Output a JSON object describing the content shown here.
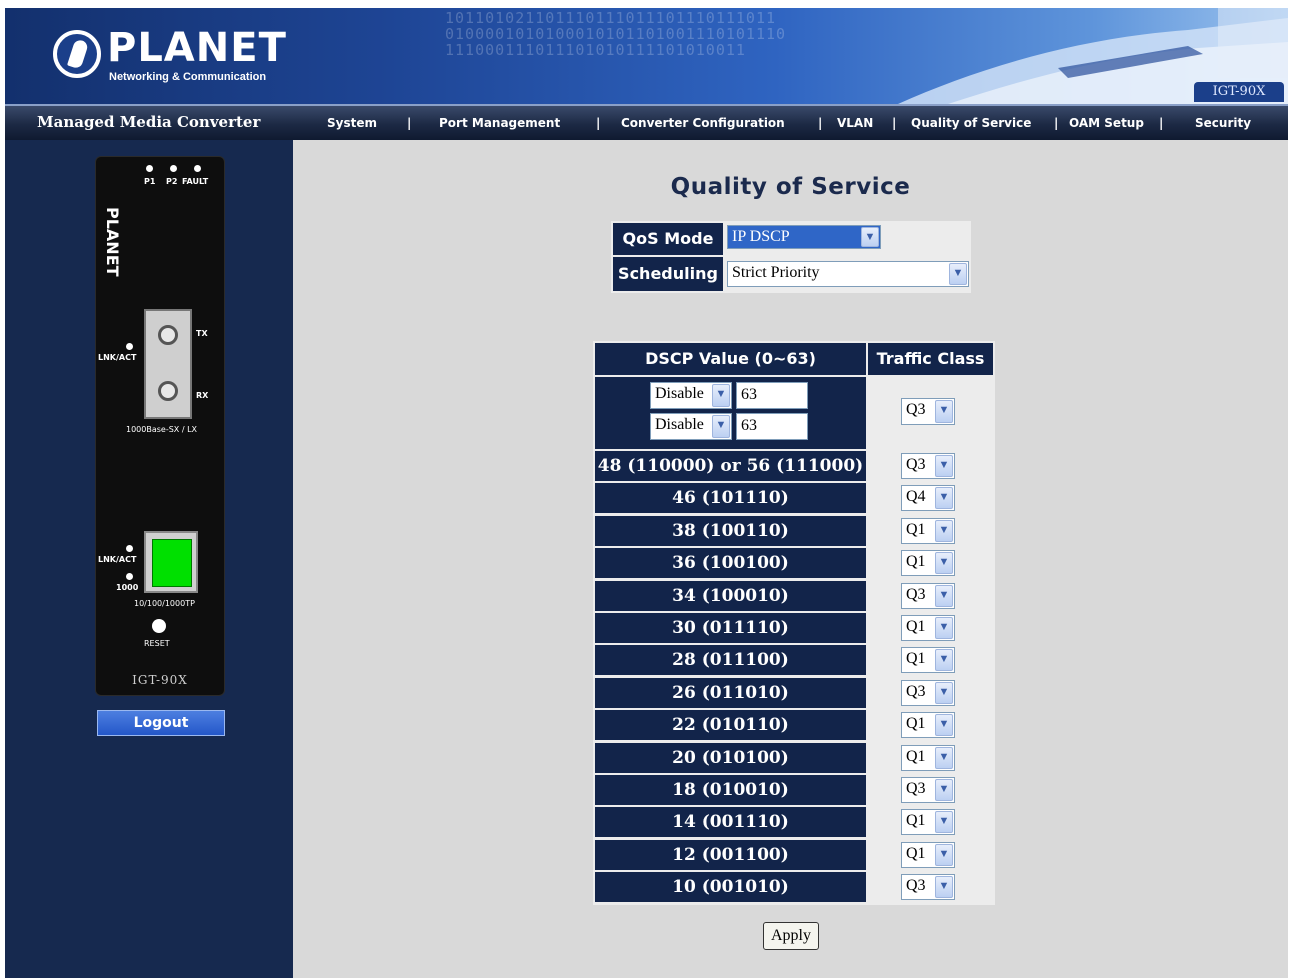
{
  "banner": {
    "logo_text": "PLANET",
    "logo_tagline": "Networking & Communication",
    "model_badge": "IGT-90X"
  },
  "navbar": {
    "product_name": "Managed Media Converter",
    "items": [
      "System",
      "Port Management",
      "Converter Configuration",
      "VLAN",
      "Quality of Service",
      "OAM Setup",
      "Security"
    ],
    "separator": "|"
  },
  "device": {
    "led_labels": {
      "p1": "P1",
      "p2": "P2",
      "fault": "FAULT"
    },
    "brand": "PLANET",
    "tx": "TX",
    "rx": "RX",
    "lnk_act": "LNK/ACT",
    "fiber_type": "1000Base-SX / LX",
    "speed_1000": "1000",
    "copper_type": "10/100/1000TP",
    "reset": "RESET",
    "model": "IGT-90X"
  },
  "left_panel": {
    "logout_label": "Logout"
  },
  "main": {
    "title": "Quality of Service",
    "qos_mode_label": "QoS Mode",
    "qos_mode_value": "IP DSCP",
    "scheduling_label": "Scheduling",
    "scheduling_value": "Strict Priority",
    "dscp_header": "DSCP Value (0~63)",
    "traffic_class_header": "Traffic Class",
    "custom_rows": [
      {
        "mode": "Disable",
        "value": "63"
      },
      {
        "mode": "Disable",
        "value": "63"
      }
    ],
    "custom_class": "Q3",
    "rows": [
      {
        "label": "48 (110000) or 56 (111000)",
        "class": "Q3"
      },
      {
        "label": "46 (101110)",
        "class": "Q4"
      },
      {
        "label": "38 (100110)",
        "class": "Q1"
      },
      {
        "label": "36 (100100)",
        "class": "Q1"
      },
      {
        "label": "34 (100010)",
        "class": "Q3"
      },
      {
        "label": "30 (011110)",
        "class": "Q1"
      },
      {
        "label": "28 (011100)",
        "class": "Q1"
      },
      {
        "label": "26 (011010)",
        "class": "Q3"
      },
      {
        "label": "22 (010110)",
        "class": "Q1"
      },
      {
        "label": "20 (010100)",
        "class": "Q1"
      },
      {
        "label": "18 (010010)",
        "class": "Q3"
      },
      {
        "label": "14 (001110)",
        "class": "Q1"
      },
      {
        "label": "12 (001100)",
        "class": "Q1"
      },
      {
        "label": "10 (001010)",
        "class": "Q3"
      }
    ],
    "apply_label": "Apply"
  }
}
